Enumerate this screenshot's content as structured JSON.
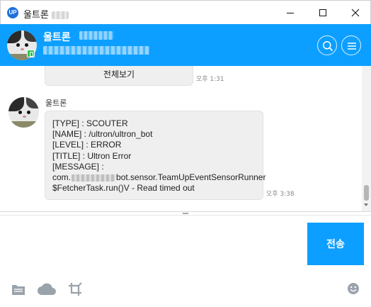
{
  "window": {
    "app_logo": "UP",
    "title": "울트론",
    "controls": [
      "minimize-icon",
      "maximize-icon",
      "close-icon"
    ]
  },
  "header": {
    "name": "울트론",
    "badge_color": "#27c24c",
    "accent": "#0d9fff",
    "buttons": [
      "search-icon",
      "menu-icon"
    ]
  },
  "chat": {
    "full_view_label": "전체보기",
    "prev_time": "오후 1:31",
    "message": {
      "sender": "울트론",
      "lines": [
        "[TYPE] : SCOUTER",
        "[NAME] : /ultron/ultron_bot",
        "[LEVEL] : ERROR",
        "[TITLE] : Ultron Error",
        "[MESSAGE] :"
      ],
      "pkg_prefix": "com.",
      "pkg_suffix": "bot.sensor.TeamUpEventSensorRunner",
      "last_line": "$FetcherTask.run()V - Read timed out",
      "time": "오후 3:38"
    }
  },
  "compose": {
    "input_value": "",
    "send_label": "전송"
  },
  "toolbar": {
    "icons": [
      "file-icon",
      "cloud-icon",
      "crop-icon",
      "emoji-icon"
    ]
  }
}
